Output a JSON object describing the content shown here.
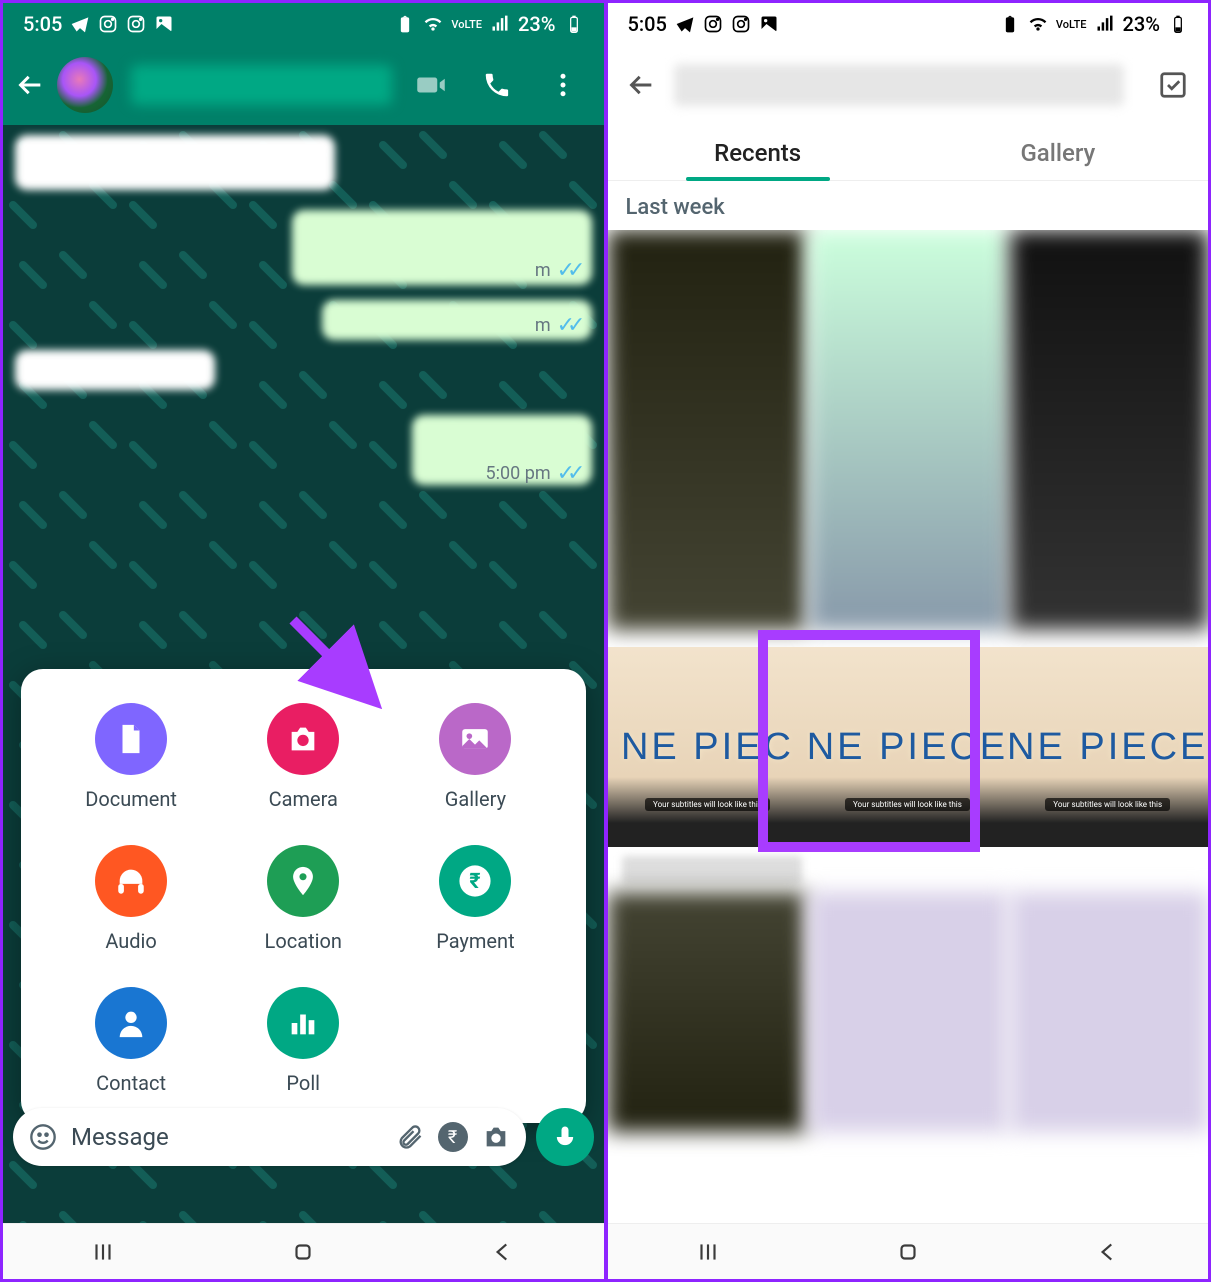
{
  "status": {
    "time": "5:05",
    "battery": "23%",
    "network_label": "VoLTE"
  },
  "chat": {
    "msg_time_1": "m",
    "msg_time_2": "m",
    "msg_time_3": "5:00 pm"
  },
  "attach": {
    "document": "Document",
    "camera": "Camera",
    "gallery": "Gallery",
    "audio": "Audio",
    "location": "Location",
    "payment": "Payment",
    "contact": "Contact",
    "poll": "Poll"
  },
  "input": {
    "placeholder": "Message",
    "rupee": "₹"
  },
  "picker": {
    "tab_recents": "Recents",
    "tab_gallery": "Gallery",
    "section_last_week": "Last week",
    "thumb_text_1": "NE PIEC",
    "thumb_text_2": "NE PIECE",
    "thumb_text_3": "NE PIECE",
    "thumb_sub": "Your subtitles will look like this"
  },
  "annotation": {
    "highlight_color": "#a83cff",
    "arrow_color": "#a83cff"
  }
}
